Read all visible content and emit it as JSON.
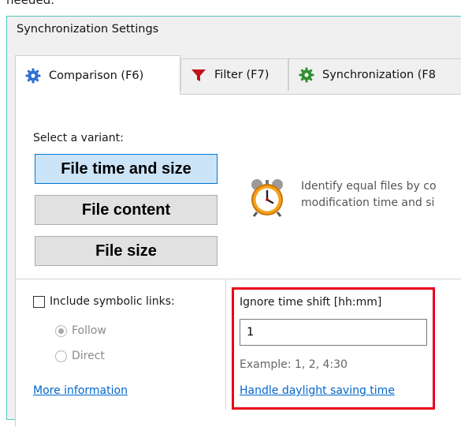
{
  "cropped_text": "needed.",
  "window": {
    "title": "Synchronization Settings"
  },
  "tabs": [
    {
      "label": "Comparison (F6)",
      "icon": "gear-icon",
      "active": true
    },
    {
      "label": "Filter (F7)",
      "icon": "funnel-icon",
      "active": false
    },
    {
      "label": "Synchronization (F8",
      "icon": "gear-green-icon",
      "active": false
    }
  ],
  "comparison": {
    "select_label": "Select a variant:",
    "variants": [
      {
        "label": "File time and size",
        "selected": true
      },
      {
        "label": "File content",
        "selected": false
      },
      {
        "label": "File size",
        "selected": false
      }
    ],
    "description_line1": "Identify equal files by co",
    "description_line2": "modification time and si"
  },
  "options": {
    "symlinks_label": "Include symbolic links:",
    "symlinks_checked": false,
    "radio_follow": "Follow",
    "radio_direct": "Direct",
    "more_info_link": "More information"
  },
  "time_shift": {
    "label": "Ignore time shift [hh:mm]",
    "value": "1",
    "example": "Example: 1, 2, 4:30",
    "dst_link": "Handle daylight saving time"
  },
  "colors": {
    "accent": "#0078d7",
    "highlight_box": "#e8001c",
    "link": "#0066cc",
    "window_border": "#4fc7c0"
  }
}
